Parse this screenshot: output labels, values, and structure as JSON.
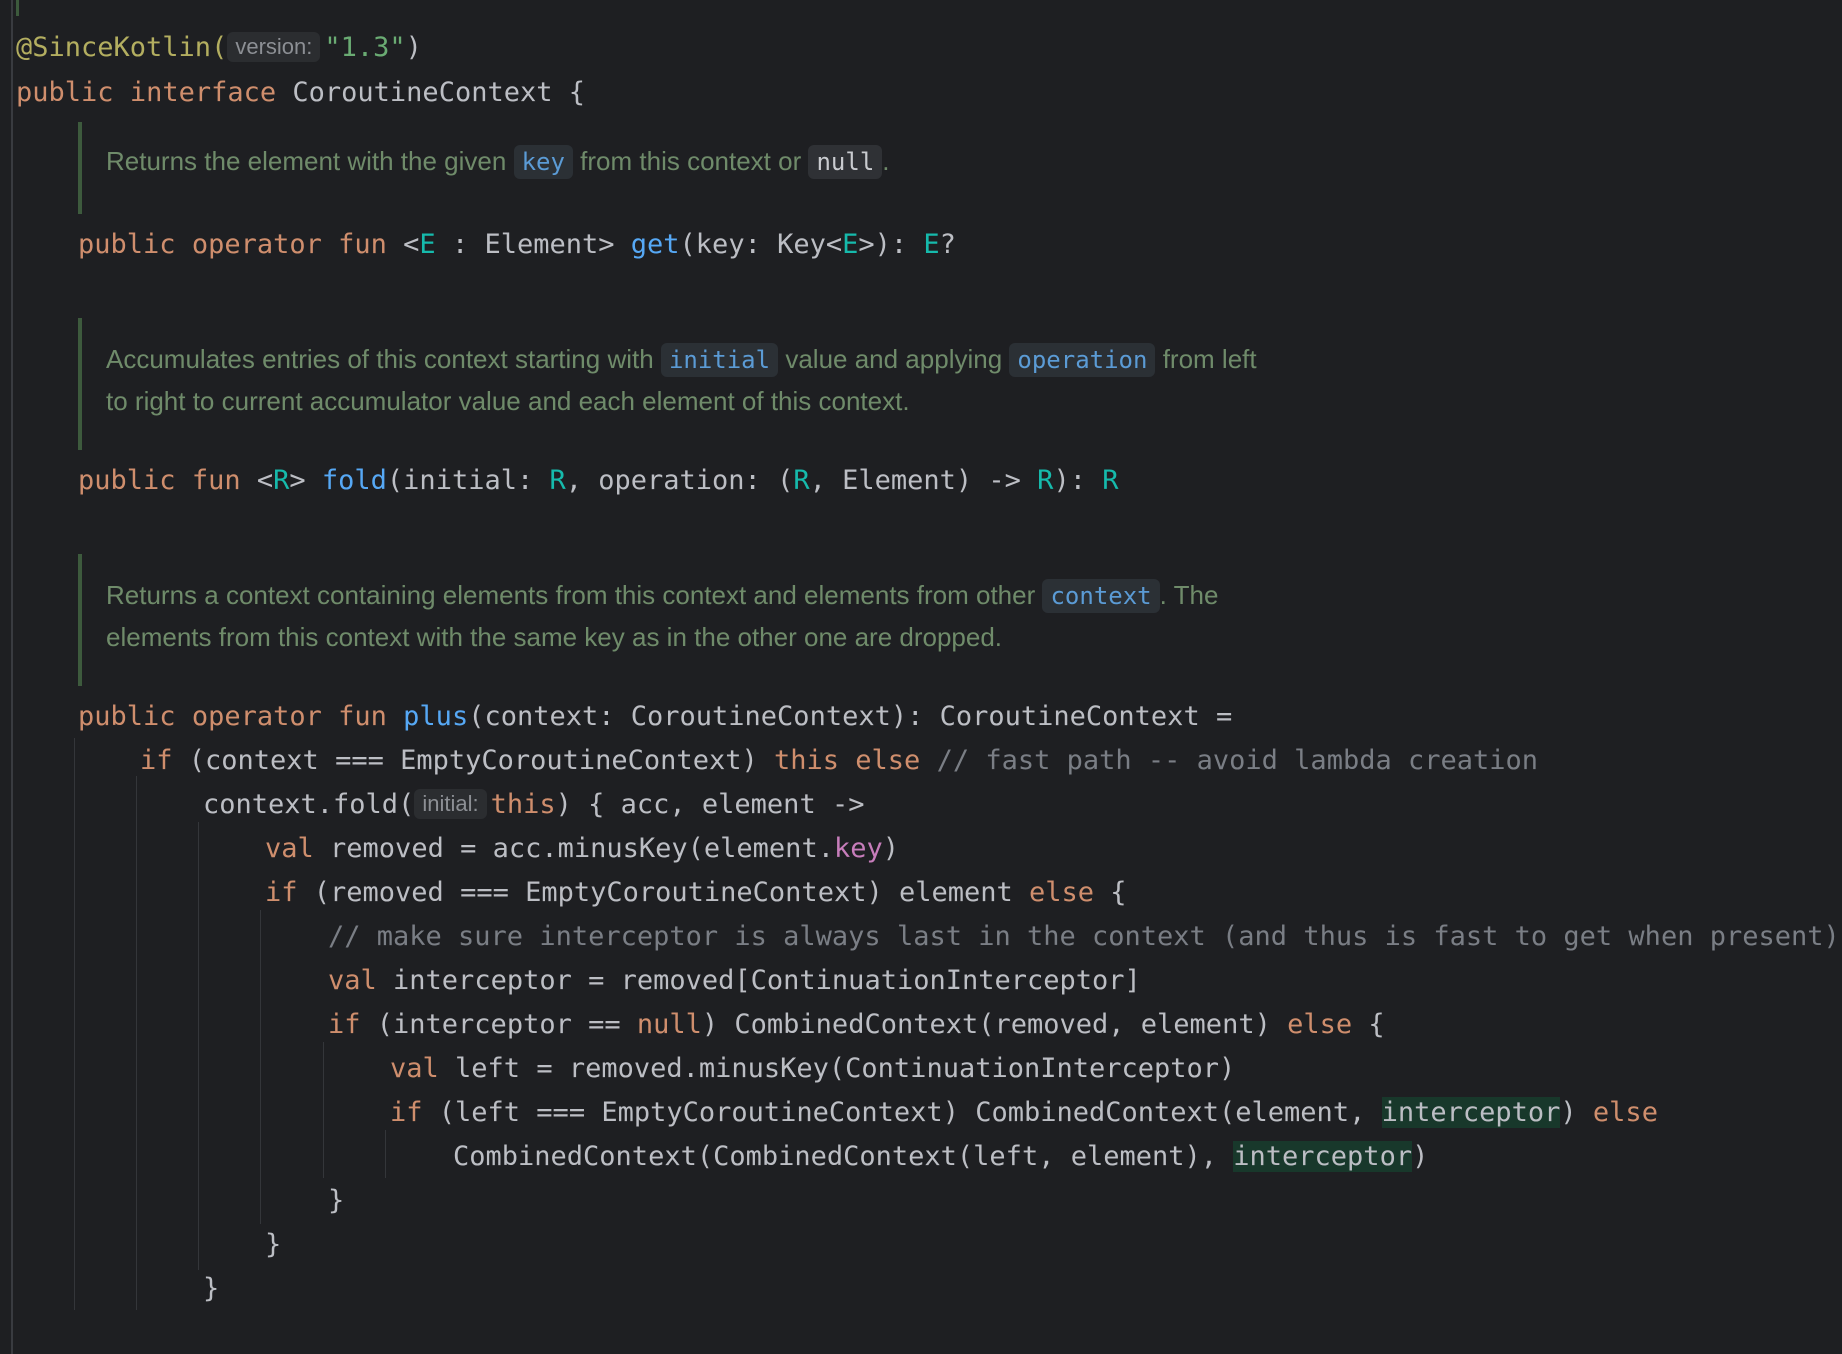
{
  "line1": {
    "annotation": "@SinceKotlin(",
    "hint": "version:",
    "string": "\"1.3\"",
    "close": ")"
  },
  "line2": {
    "kw1": "public",
    "kw2": "interface",
    "name": "CoroutineContext {"
  },
  "doc1": {
    "t1": "Returns the element with the given",
    "c1": "key",
    "t2": "from this context or",
    "c2": "null",
    "t3": "."
  },
  "get_line": {
    "kw1": "public",
    "kw2": "operator",
    "kw3": "fun",
    "p1": " <",
    "tp1": "E",
    "p2": " : Element> ",
    "fn": "get",
    "p3": "(key: Key<",
    "tp2": "E",
    "p4": ">): ",
    "tp3": "E",
    "p5": "?"
  },
  "doc2": {
    "t1": "Accumulates entries of this context starting with",
    "c1": "initial",
    "t2": "value and applying",
    "c2": "operation",
    "t3": "from left",
    "t4": "to right to current accumulator value and each element of this context."
  },
  "fold_line": {
    "kw1": "public",
    "kw2": "fun",
    "p1": " <",
    "tp1": "R",
    "p2": "> ",
    "fn": "fold",
    "p3": "(initial: ",
    "tp2": "R",
    "p4": ", operation: (",
    "tp3": "R",
    "p5": ", Element) -> ",
    "tp4": "R",
    "p6": "): ",
    "tp5": "R"
  },
  "doc3": {
    "t1": "Returns a context containing elements from this context and elements from other",
    "c1": "context",
    "t2": ". The",
    "t3": "elements from this context with the same key as in the other one are dropped."
  },
  "plus_line": {
    "kw1": "public",
    "kw2": "operator",
    "kw3": "fun",
    "fn": "plus",
    "rest": "(context: CoroutineContext): CoroutineContext ="
  },
  "line_if1": {
    "kw1": "if",
    "p1": " (context === EmptyCoroutineContext) ",
    "kw2": "this",
    "kw3": "else",
    "cmt": "// fast path -- avoid lambda creation"
  },
  "line_fold_call": {
    "p1": "context.fold(",
    "hint": "initial:",
    "kw": "this",
    "p2": ") { acc, element ->"
  },
  "line_val_removed": {
    "kw": "val",
    "p1": " removed = acc.minusKey(element.",
    "prop": "key",
    "p2": ")"
  },
  "line_if_removed": {
    "kw1": "if",
    "p1": " (removed === EmptyCoroutineContext) element ",
    "kw2": "else",
    "p2": " {"
  },
  "line_comment": {
    "cmt": "// make sure interceptor is always last in the context (and thus is fast to get when present)"
  },
  "line_val_interceptor": {
    "kw": "val",
    "p1": " interceptor = removed[ContinuationInterceptor]"
  },
  "line_if_interceptor": {
    "kw1": "if",
    "p1": " (interceptor == ",
    "kw2": "null",
    "p2": ") CombinedContext(removed, element) ",
    "kw3": "else",
    "p3": " {"
  },
  "line_val_left": {
    "kw": "val",
    "p1": " left = removed.minusKey(ContinuationInterceptor)"
  },
  "line_if_left": {
    "kw1": "if",
    "p1": " (left === EmptyCoroutineContext) CombinedContext(element, ",
    "hl": "interceptor",
    "p2": ") ",
    "kw2": "else"
  },
  "line_combined": {
    "p1": "CombinedContext(CombinedContext(left, element), ",
    "hl": "interceptor",
    "p2": ")"
  },
  "brace1": "}",
  "brace2": "}",
  "brace3": "}"
}
